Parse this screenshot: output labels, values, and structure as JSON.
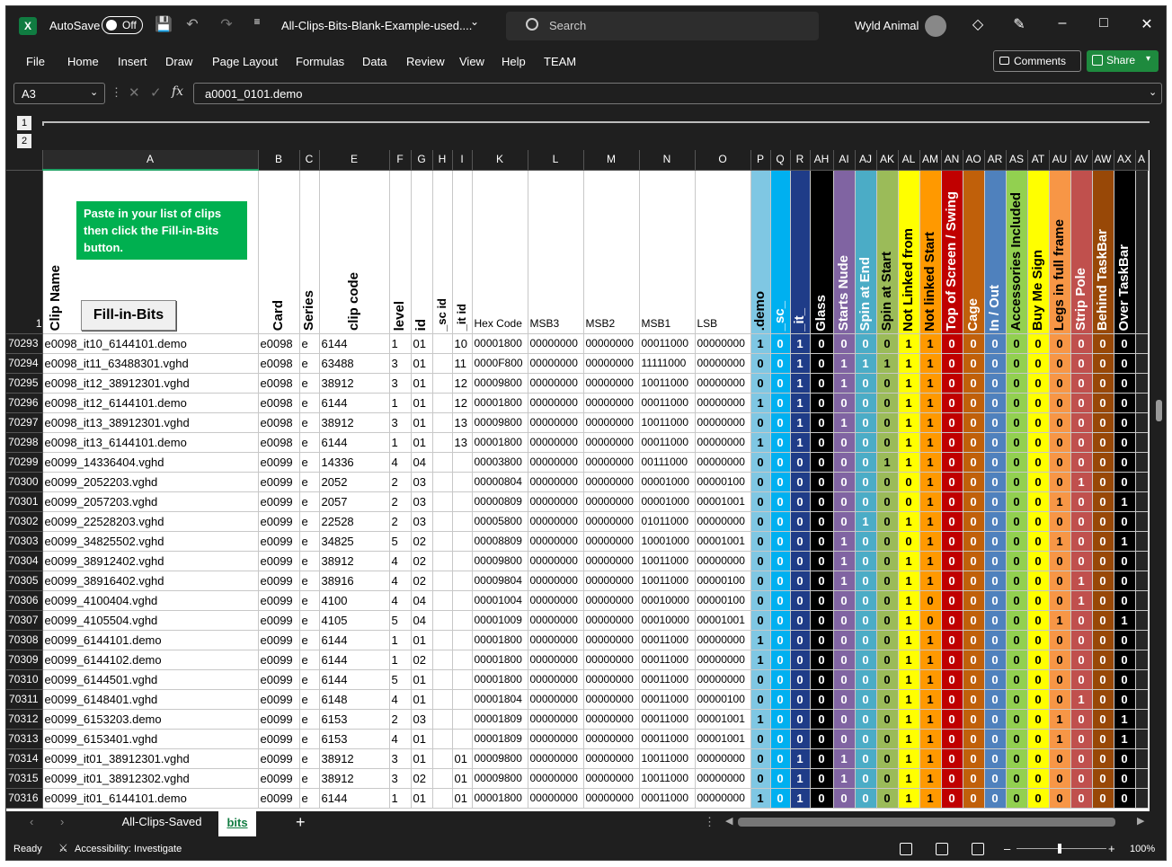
{
  "titlebar": {
    "autosave_label": "AutoSave",
    "autosave_state": "Off",
    "filename": "All-Clips-Bits-Blank-Example-used....",
    "search_placeholder": "Search",
    "user": "Wyld Animal"
  },
  "menu": [
    "File",
    "Home",
    "Insert",
    "Draw",
    "Page Layout",
    "Formulas",
    "Data",
    "Review",
    "View",
    "Help",
    "TEAM"
  ],
  "comments_label": "Comments",
  "share_label": "Share",
  "formula": {
    "name_box": "A3",
    "value": "a0001_0101.demo"
  },
  "outline_levels": [
    "1",
    "2"
  ],
  "columns": [
    "A",
    "B",
    "C",
    "E",
    "F",
    "G",
    "H",
    "I",
    "K",
    "L",
    "M",
    "N",
    "O",
    "P",
    "Q",
    "R",
    "AH",
    "AI",
    "AJ",
    "AK",
    "AL",
    "AM",
    "AN",
    "AO",
    "AR",
    "AS",
    "AT",
    "AU",
    "AV",
    "AW",
    "AX",
    "A"
  ],
  "header_row_num": "1",
  "headers": {
    "A": "Clip Name",
    "B": "Card",
    "C": "Series",
    "E": "clip code",
    "F": "level",
    "G": "id",
    "H": "_sc id",
    "I": "_it id",
    "K": "Hex Code",
    "L": "MSB3",
    "M": "MSB2",
    "N": "MSB1",
    "O": "LSB"
  },
  "bit_headers": [
    ".demo",
    "_sc_",
    "_it_",
    "Glass",
    "Starts Nude",
    "Spin at End",
    "Spin at Start",
    "Not Linked from",
    "Not linked Start",
    "Top of Screen / Swing",
    "Cage",
    "In / Out",
    "Accessories Included",
    "Buy Me Sign",
    "Legs in full frame",
    "Strip Pole",
    "Behind TaskBar",
    "Over TaskBar",
    ""
  ],
  "bit_colors": [
    "#7fc7e3",
    "#00b0f0",
    "#1f3c88",
    "#000000",
    "#8064a2",
    "#4bacc6",
    "#9bbb59",
    "#ffff00",
    "#ff9900",
    "#c00000",
    "#c0600a",
    "#4f81bd",
    "#92d050",
    "#ffff00",
    "#f79646",
    "#c0504d",
    "#984807",
    "#000000",
    "#262626"
  ],
  "bit_text_colors": [
    "#000",
    "#fff",
    "#fff",
    "#fff",
    "#fff",
    "#fff",
    "#000",
    "#000",
    "#000",
    "#fff",
    "#fff",
    "#fff",
    "#000",
    "#000",
    "#000",
    "#fff",
    "#fff",
    "#fff",
    "#fff"
  ],
  "green_box_text": "Paste in your list of clips then click the Fill-in-Bits button.",
  "fill_button_label": "Fill-in-Bits",
  "rows": [
    {
      "n": "70293",
      "A": "e0098_it10_6144101.demo",
      "B": "e0098",
      "C": "e",
      "E": "6144",
      "F": "1",
      "G": "01",
      "H": "",
      "I": "10",
      "K": "00001800",
      "L": "00000000",
      "M": "00000000",
      "N": "00011000",
      "O": "00000000",
      "bits": [
        "1",
        "0",
        "1",
        "0",
        "0",
        "0",
        "0",
        "1",
        "1",
        "0",
        "0",
        "0",
        "0",
        "0",
        "0",
        "0",
        "0",
        "0",
        ""
      ]
    },
    {
      "n": "70294",
      "A": "e0098_it11_63488301.vghd",
      "B": "e0098",
      "C": "e",
      "E": "63488",
      "F": "3",
      "G": "01",
      "H": "",
      "I": "11",
      "K": "0000F800",
      "L": "00000000",
      "M": "00000000",
      "N": "11111000",
      "O": "00000000",
      "bits": [
        "0",
        "0",
        "1",
        "0",
        "1",
        "1",
        "1",
        "1",
        "1",
        "0",
        "0",
        "0",
        "0",
        "0",
        "0",
        "0",
        "0",
        "0",
        ""
      ]
    },
    {
      "n": "70295",
      "A": "e0098_it12_38912301.vghd",
      "B": "e0098",
      "C": "e",
      "E": "38912",
      "F": "3",
      "G": "01",
      "H": "",
      "I": "12",
      "K": "00009800",
      "L": "00000000",
      "M": "00000000",
      "N": "10011000",
      "O": "00000000",
      "bits": [
        "0",
        "0",
        "1",
        "0",
        "1",
        "0",
        "0",
        "1",
        "1",
        "0",
        "0",
        "0",
        "0",
        "0",
        "0",
        "0",
        "0",
        "0",
        ""
      ]
    },
    {
      "n": "70296",
      "A": "e0098_it12_6144101.demo",
      "B": "e0098",
      "C": "e",
      "E": "6144",
      "F": "1",
      "G": "01",
      "H": "",
      "I": "12",
      "K": "00001800",
      "L": "00000000",
      "M": "00000000",
      "N": "00011000",
      "O": "00000000",
      "bits": [
        "1",
        "0",
        "1",
        "0",
        "0",
        "0",
        "0",
        "1",
        "1",
        "0",
        "0",
        "0",
        "0",
        "0",
        "0",
        "0",
        "0",
        "0",
        ""
      ]
    },
    {
      "n": "70297",
      "A": "e0098_it13_38912301.vghd",
      "B": "e0098",
      "C": "e",
      "E": "38912",
      "F": "3",
      "G": "01",
      "H": "",
      "I": "13",
      "K": "00009800",
      "L": "00000000",
      "M": "00000000",
      "N": "10011000",
      "O": "00000000",
      "bits": [
        "0",
        "0",
        "1",
        "0",
        "1",
        "0",
        "0",
        "1",
        "1",
        "0",
        "0",
        "0",
        "0",
        "0",
        "0",
        "0",
        "0",
        "0",
        ""
      ]
    },
    {
      "n": "70298",
      "A": "e0098_it13_6144101.demo",
      "B": "e0098",
      "C": "e",
      "E": "6144",
      "F": "1",
      "G": "01",
      "H": "",
      "I": "13",
      "K": "00001800",
      "L": "00000000",
      "M": "00000000",
      "N": "00011000",
      "O": "00000000",
      "bits": [
        "1",
        "0",
        "1",
        "0",
        "0",
        "0",
        "0",
        "1",
        "1",
        "0",
        "0",
        "0",
        "0",
        "0",
        "0",
        "0",
        "0",
        "0",
        ""
      ]
    },
    {
      "n": "70299",
      "A": "e0099_14336404.vghd",
      "B": "e0099",
      "C": "e",
      "E": "14336",
      "F": "4",
      "G": "04",
      "H": "",
      "I": "",
      "K": "00003800",
      "L": "00000000",
      "M": "00000000",
      "N": "00111000",
      "O": "00000000",
      "bits": [
        "0",
        "0",
        "0",
        "0",
        "0",
        "0",
        "1",
        "1",
        "1",
        "0",
        "0",
        "0",
        "0",
        "0",
        "0",
        "0",
        "0",
        "0",
        ""
      ]
    },
    {
      "n": "70300",
      "A": "e0099_2052203.vghd",
      "B": "e0099",
      "C": "e",
      "E": "2052",
      "F": "2",
      "G": "03",
      "H": "",
      "I": "",
      "K": "00000804",
      "L": "00000000",
      "M": "00000000",
      "N": "00001000",
      "O": "00000100",
      "bits": [
        "0",
        "0",
        "0",
        "0",
        "0",
        "0",
        "0",
        "0",
        "1",
        "0",
        "0",
        "0",
        "0",
        "0",
        "0",
        "1",
        "0",
        "0",
        ""
      ]
    },
    {
      "n": "70301",
      "A": "e0099_2057203.vghd",
      "B": "e0099",
      "C": "e",
      "E": "2057",
      "F": "2",
      "G": "03",
      "H": "",
      "I": "",
      "K": "00000809",
      "L": "00000000",
      "M": "00000000",
      "N": "00001000",
      "O": "00001001",
      "bits": [
        "0",
        "0",
        "0",
        "0",
        "0",
        "0",
        "0",
        "0",
        "1",
        "0",
        "0",
        "0",
        "0",
        "0",
        "1",
        "0",
        "0",
        "1",
        ""
      ]
    },
    {
      "n": "70302",
      "A": "e0099_22528203.vghd",
      "B": "e0099",
      "C": "e",
      "E": "22528",
      "F": "2",
      "G": "03",
      "H": "",
      "I": "",
      "K": "00005800",
      "L": "00000000",
      "M": "00000000",
      "N": "01011000",
      "O": "00000000",
      "bits": [
        "0",
        "0",
        "0",
        "0",
        "0",
        "1",
        "0",
        "1",
        "1",
        "0",
        "0",
        "0",
        "0",
        "0",
        "0",
        "0",
        "0",
        "0",
        ""
      ]
    },
    {
      "n": "70303",
      "A": "e0099_34825502.vghd",
      "B": "e0099",
      "C": "e",
      "E": "34825",
      "F": "5",
      "G": "02",
      "H": "",
      "I": "",
      "K": "00008809",
      "L": "00000000",
      "M": "00000000",
      "N": "10001000",
      "O": "00001001",
      "bits": [
        "0",
        "0",
        "0",
        "0",
        "1",
        "0",
        "0",
        "0",
        "1",
        "0",
        "0",
        "0",
        "0",
        "0",
        "1",
        "0",
        "0",
        "1",
        ""
      ]
    },
    {
      "n": "70304",
      "A": "e0099_38912402.vghd",
      "B": "e0099",
      "C": "e",
      "E": "38912",
      "F": "4",
      "G": "02",
      "H": "",
      "I": "",
      "K": "00009800",
      "L": "00000000",
      "M": "00000000",
      "N": "10011000",
      "O": "00000000",
      "bits": [
        "0",
        "0",
        "0",
        "0",
        "1",
        "0",
        "0",
        "1",
        "1",
        "0",
        "0",
        "0",
        "0",
        "0",
        "0",
        "0",
        "0",
        "0",
        ""
      ]
    },
    {
      "n": "70305",
      "A": "e0099_38916402.vghd",
      "B": "e0099",
      "C": "e",
      "E": "38916",
      "F": "4",
      "G": "02",
      "H": "",
      "I": "",
      "K": "00009804",
      "L": "00000000",
      "M": "00000000",
      "N": "10011000",
      "O": "00000100",
      "bits": [
        "0",
        "0",
        "0",
        "0",
        "1",
        "0",
        "0",
        "1",
        "1",
        "0",
        "0",
        "0",
        "0",
        "0",
        "0",
        "1",
        "0",
        "0",
        ""
      ]
    },
    {
      "n": "70306",
      "A": "e0099_4100404.vghd",
      "B": "e0099",
      "C": "e",
      "E": "4100",
      "F": "4",
      "G": "04",
      "H": "",
      "I": "",
      "K": "00001004",
      "L": "00000000",
      "M": "00000000",
      "N": "00010000",
      "O": "00000100",
      "bits": [
        "0",
        "0",
        "0",
        "0",
        "0",
        "0",
        "0",
        "1",
        "0",
        "0",
        "0",
        "0",
        "0",
        "0",
        "0",
        "1",
        "0",
        "0",
        ""
      ]
    },
    {
      "n": "70307",
      "A": "e0099_4105504.vghd",
      "B": "e0099",
      "C": "e",
      "E": "4105",
      "F": "5",
      "G": "04",
      "H": "",
      "I": "",
      "K": "00001009",
      "L": "00000000",
      "M": "00000000",
      "N": "00010000",
      "O": "00001001",
      "bits": [
        "0",
        "0",
        "0",
        "0",
        "0",
        "0",
        "0",
        "1",
        "0",
        "0",
        "0",
        "0",
        "0",
        "0",
        "1",
        "0",
        "0",
        "1",
        ""
      ]
    },
    {
      "n": "70308",
      "A": "e0099_6144101.demo",
      "B": "e0099",
      "C": "e",
      "E": "6144",
      "F": "1",
      "G": "01",
      "H": "",
      "I": "",
      "K": "00001800",
      "L": "00000000",
      "M": "00000000",
      "N": "00011000",
      "O": "00000000",
      "bits": [
        "1",
        "0",
        "0",
        "0",
        "0",
        "0",
        "0",
        "1",
        "1",
        "0",
        "0",
        "0",
        "0",
        "0",
        "0",
        "0",
        "0",
        "0",
        ""
      ]
    },
    {
      "n": "70309",
      "A": "e0099_6144102.demo",
      "B": "e0099",
      "C": "e",
      "E": "6144",
      "F": "1",
      "G": "02",
      "H": "",
      "I": "",
      "K": "00001800",
      "L": "00000000",
      "M": "00000000",
      "N": "00011000",
      "O": "00000000",
      "bits": [
        "1",
        "0",
        "0",
        "0",
        "0",
        "0",
        "0",
        "1",
        "1",
        "0",
        "0",
        "0",
        "0",
        "0",
        "0",
        "0",
        "0",
        "0",
        ""
      ]
    },
    {
      "n": "70310",
      "A": "e0099_6144501.vghd",
      "B": "e0099",
      "C": "e",
      "E": "6144",
      "F": "5",
      "G": "01",
      "H": "",
      "I": "",
      "K": "00001800",
      "L": "00000000",
      "M": "00000000",
      "N": "00011000",
      "O": "00000000",
      "bits": [
        "0",
        "0",
        "0",
        "0",
        "0",
        "0",
        "0",
        "1",
        "1",
        "0",
        "0",
        "0",
        "0",
        "0",
        "0",
        "0",
        "0",
        "0",
        ""
      ]
    },
    {
      "n": "70311",
      "A": "e0099_6148401.vghd",
      "B": "e0099",
      "C": "e",
      "E": "6148",
      "F": "4",
      "G": "01",
      "H": "",
      "I": "",
      "K": "00001804",
      "L": "00000000",
      "M": "00000000",
      "N": "00011000",
      "O": "00000100",
      "bits": [
        "0",
        "0",
        "0",
        "0",
        "0",
        "0",
        "0",
        "1",
        "1",
        "0",
        "0",
        "0",
        "0",
        "0",
        "0",
        "1",
        "0",
        "0",
        ""
      ]
    },
    {
      "n": "70312",
      "A": "e0099_6153203.demo",
      "B": "e0099",
      "C": "e",
      "E": "6153",
      "F": "2",
      "G": "03",
      "H": "",
      "I": "",
      "K": "00001809",
      "L": "00000000",
      "M": "00000000",
      "N": "00011000",
      "O": "00001001",
      "bits": [
        "1",
        "0",
        "0",
        "0",
        "0",
        "0",
        "0",
        "1",
        "1",
        "0",
        "0",
        "0",
        "0",
        "0",
        "1",
        "0",
        "0",
        "1",
        ""
      ]
    },
    {
      "n": "70313",
      "A": "e0099_6153401.vghd",
      "B": "e0099",
      "C": "e",
      "E": "6153",
      "F": "4",
      "G": "01",
      "H": "",
      "I": "",
      "K": "00001809",
      "L": "00000000",
      "M": "00000000",
      "N": "00011000",
      "O": "00001001",
      "bits": [
        "0",
        "0",
        "0",
        "0",
        "0",
        "0",
        "0",
        "1",
        "1",
        "0",
        "0",
        "0",
        "0",
        "0",
        "1",
        "0",
        "0",
        "1",
        ""
      ]
    },
    {
      "n": "70314",
      "A": "e0099_it01_38912301.vghd",
      "B": "e0099",
      "C": "e",
      "E": "38912",
      "F": "3",
      "G": "01",
      "H": "",
      "I": "01",
      "K": "00009800",
      "L": "00000000",
      "M": "00000000",
      "N": "10011000",
      "O": "00000000",
      "bits": [
        "0",
        "0",
        "1",
        "0",
        "1",
        "0",
        "0",
        "1",
        "1",
        "0",
        "0",
        "0",
        "0",
        "0",
        "0",
        "0",
        "0",
        "0",
        ""
      ]
    },
    {
      "n": "70315",
      "A": "e0099_it01_38912302.vghd",
      "B": "e0099",
      "C": "e",
      "E": "38912",
      "F": "3",
      "G": "02",
      "H": "",
      "I": "01",
      "K": "00009800",
      "L": "00000000",
      "M": "00000000",
      "N": "10011000",
      "O": "00000000",
      "bits": [
        "0",
        "0",
        "1",
        "0",
        "1",
        "0",
        "0",
        "1",
        "1",
        "0",
        "0",
        "0",
        "0",
        "0",
        "0",
        "0",
        "0",
        "0",
        ""
      ]
    },
    {
      "n": "70316",
      "A": "e0099_it01_6144101.demo",
      "B": "e0099",
      "C": "e",
      "E": "6144",
      "F": "1",
      "G": "01",
      "H": "",
      "I": "01",
      "K": "00001800",
      "L": "00000000",
      "M": "00000000",
      "N": "00011000",
      "O": "00000000",
      "bits": [
        "1",
        "0",
        "1",
        "0",
        "0",
        "0",
        "0",
        "1",
        "1",
        "0",
        "0",
        "0",
        "0",
        "0",
        "0",
        "0",
        "0",
        "0",
        ""
      ]
    }
  ],
  "sheet_tabs": [
    "All-Clips-Saved",
    "bits"
  ],
  "status": {
    "ready": "Ready",
    "accessibility": "Accessibility: Investigate",
    "zoom": "100%"
  }
}
